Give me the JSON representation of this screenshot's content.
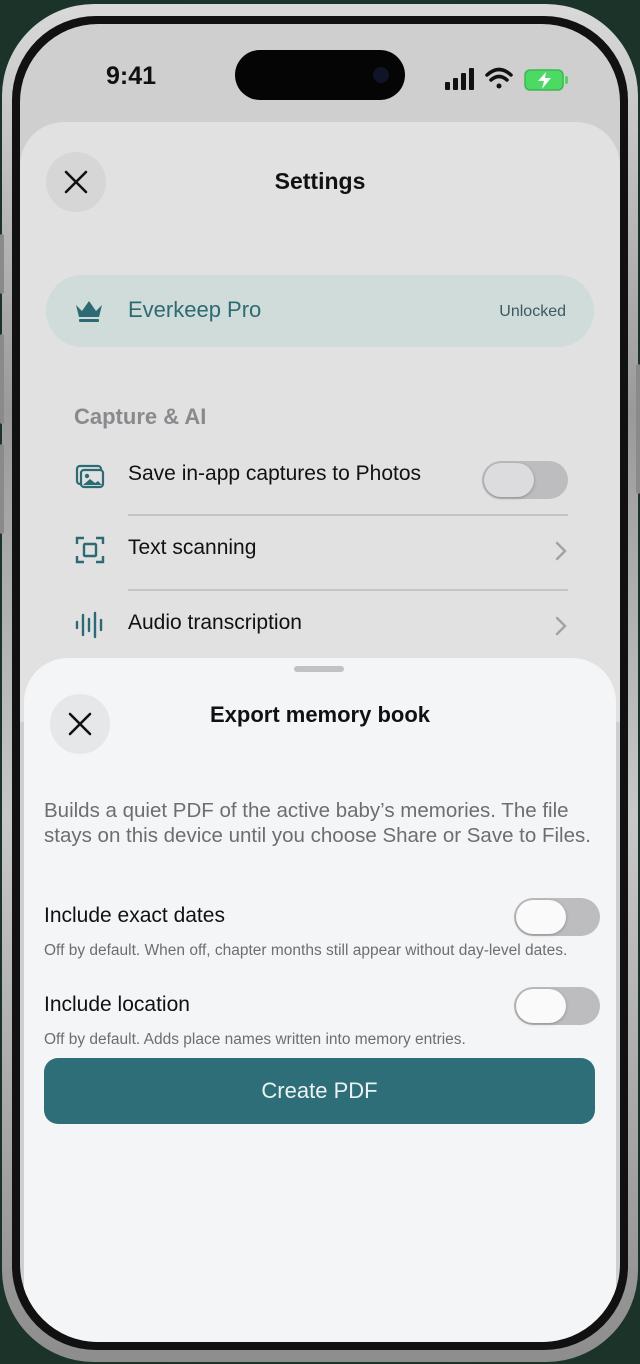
{
  "status_bar": {
    "time": "9:41",
    "icons": [
      "signal-icon",
      "wifi-icon",
      "battery-charging-icon"
    ]
  },
  "settings": {
    "title": "Settings",
    "close_icon": "close-icon",
    "pro": {
      "icon": "crown-icon",
      "label": "Everkeep Pro",
      "status": "Unlocked"
    },
    "section": "Capture & AI",
    "rows": [
      {
        "icon": "photos-icon",
        "label": "Save in-app captures to Photos",
        "control": "toggle",
        "on": false
      },
      {
        "icon": "scan-icon",
        "label": "Text scanning",
        "control": "chevron"
      },
      {
        "icon": "waveform-icon",
        "label": "Audio transcription",
        "control": "chevron"
      }
    ]
  },
  "export_sheet": {
    "title": "Export memory book",
    "close_icon": "close-icon",
    "description": "Builds a quiet PDF of the active baby’s memories. The file stays on this device until you choose Share or Save to Files.",
    "options": [
      {
        "label": "Include exact dates",
        "subtitle": "Off by default. When off, chapter months still appear without day-level dates.",
        "on": false
      },
      {
        "label": "Include location",
        "subtitle": "Off by default. Adds place names written into memory entries.",
        "on": false
      }
    ],
    "create_button": "Create PDF"
  },
  "colors": {
    "accent": "#2e6e79",
    "pro_card": "#cfdcda",
    "background": "#1f3a30"
  }
}
